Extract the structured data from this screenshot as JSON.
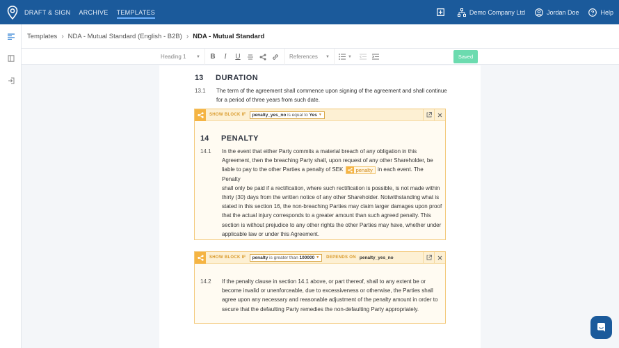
{
  "topbar": {
    "nav": [
      {
        "label": "DRAFT & SIGN",
        "active": false
      },
      {
        "label": "ARCHIVE",
        "active": false
      },
      {
        "label": "TEMPLATES",
        "active": true
      }
    ],
    "company": "Demo Company Ltd",
    "user": "Jordan Doe",
    "help": "Help"
  },
  "breadcrumb": {
    "items": [
      "Templates",
      "NDA - Mutual Standard (English - B2B)"
    ],
    "current": "NDA - Mutual Standard"
  },
  "toolbar": {
    "heading_select": "Heading 1",
    "references_select": "References",
    "saved_label": "Saved"
  },
  "document": {
    "section13": {
      "number": "13",
      "title": "DURATION",
      "clause_number": "13.1",
      "clause_lines": [
        "The term of the agreement shall commence upon signing of the agreement and shall continue",
        "for a period of three years from such date."
      ]
    },
    "block1": {
      "show_if_label": "SHOW BLOCK IF",
      "condition": {
        "variable": "penalty_yes_no",
        "operator": "is equal to",
        "value": "Yes"
      },
      "section_number": "14",
      "section_title": "PENALTY",
      "clause_number": "14.1",
      "line1": "In the event that either Party commits a material breach of any obligation in this",
      "line2": "Agreement, then the breaching Party shall, upon request of any other Shareholder, be",
      "line3_before": "liable to pay to the other Parties a penalty of SEK",
      "variable_chip": "penalty",
      "line3_after": "in each event. The Penalty",
      "lines_rest": [
        "shall only be paid if a rectification, where such rectification is possible, is not made within",
        "thirty (30) days from the written notice of any other Shareholder. Notwithstanding what is",
        "stated in this section 16, the non-breaching Parties may claim larger damages upon proof",
        "that the actual injury corresponds to a greater amount than such agreed penalty. This",
        "section is without prejudice to any other rights the other Parties may have, whether under",
        "applicable law or under this Agreement."
      ]
    },
    "block2": {
      "show_if_label": "SHOW BLOCK IF",
      "condition": {
        "variable": "penalty",
        "operator": "is greater than",
        "value": "100000"
      },
      "depends_label": "DEPENDS ON",
      "depends_value": "penalty_yes_no",
      "clause_number": "14.2",
      "clause_lines": [
        "If the penalty clause in section 14.1 above, or part thereof, shall to any extent be or",
        "become invalid or unenforceable, due to excessiveness or otherwise, the Parties shall",
        "agree upon any necessary and reasonable adjustment of the penalty amount in order to",
        "secure that the defaulting Party remedies the non-defaulting Party appropriately."
      ]
    }
  },
  "colors": {
    "brand": "#1b5a9b",
    "saved": "#6cdbaf",
    "condition_accent": "#f5b443"
  }
}
